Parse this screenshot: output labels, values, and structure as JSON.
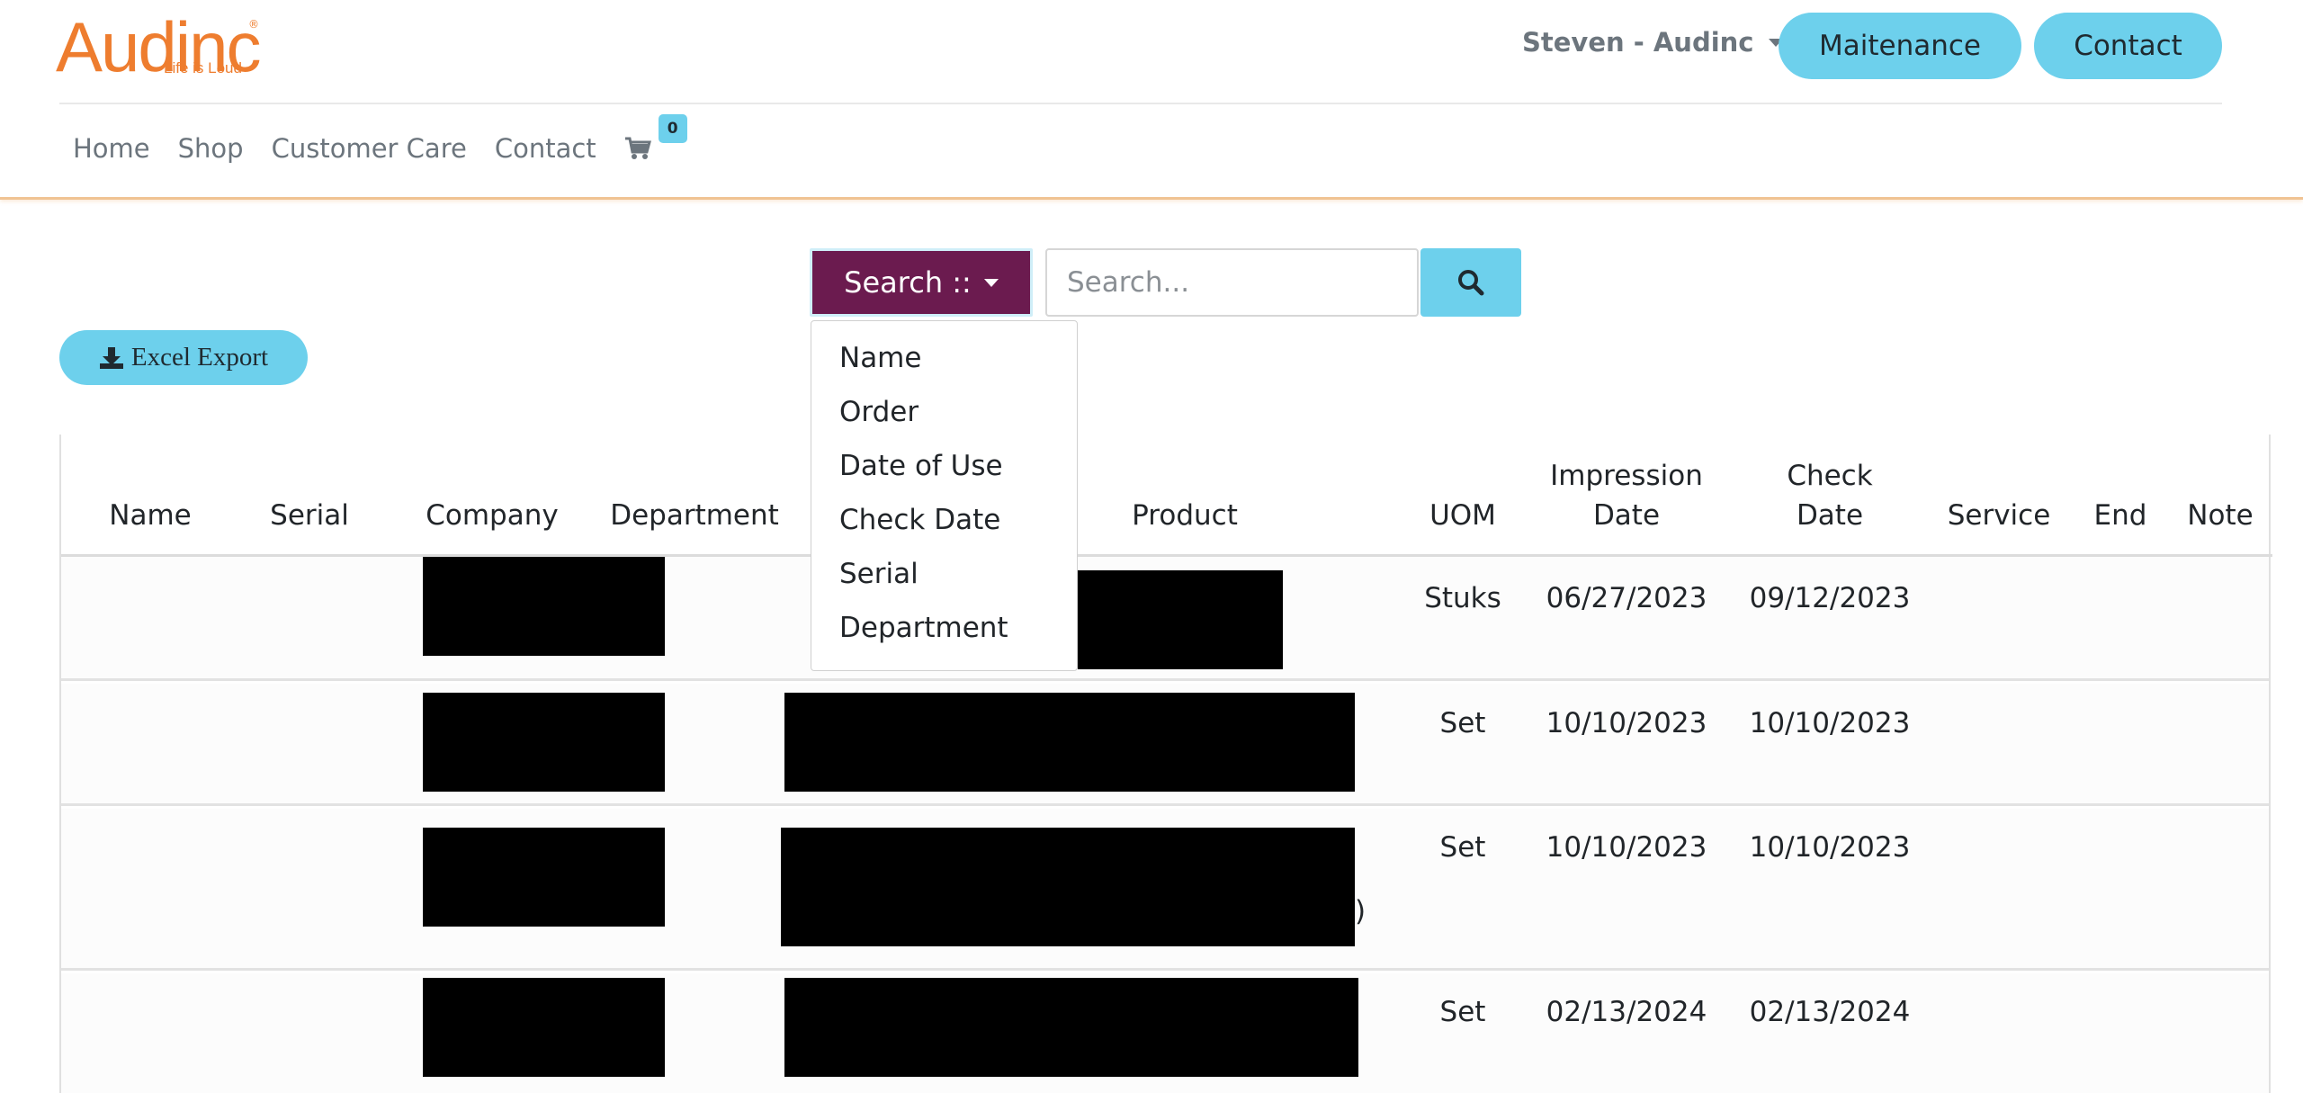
{
  "header": {
    "logo_text": "Audinc",
    "logo_tagline": "Life is Loud",
    "user_label": "Steven - Audinc",
    "maintenance_label": "Maitenance",
    "contact_label": "Contact"
  },
  "nav": {
    "items": [
      "Home",
      "Shop",
      "Customer Care",
      "Contact"
    ],
    "cart_count": "0"
  },
  "search": {
    "dropdown_label": "Search ::",
    "placeholder": "Search...",
    "options": [
      "Name",
      "Order",
      "Date of Use",
      "Check Date",
      "Serial",
      "Department"
    ]
  },
  "export": {
    "label": "Excel Export"
  },
  "table": {
    "headers": {
      "name": "Name",
      "serial": "Serial",
      "company": "Company",
      "department": "Department",
      "product": "Product",
      "uom": "UOM",
      "impression_1": "Impression",
      "impression_2": "Date",
      "check_1": "Check",
      "check_2": "Date",
      "service": "Service",
      "end": "End",
      "note": "Note"
    },
    "rows": [
      {
        "uom": "Stuks",
        "impression_date": "06/27/2023",
        "check_date": "09/12/2023"
      },
      {
        "uom": "Set",
        "impression_date": "10/10/2023",
        "check_date": "10/10/2023"
      },
      {
        "uom": "Set",
        "impression_date": "10/10/2023",
        "check_date": "10/10/2023"
      },
      {
        "uom": "Set",
        "impression_date": "02/13/2024",
        "check_date": "02/13/2024"
      }
    ]
  },
  "colors": {
    "accent": "#6dd0ec",
    "brand": "#ee7d2f",
    "search_button": "#6b1b4f"
  }
}
